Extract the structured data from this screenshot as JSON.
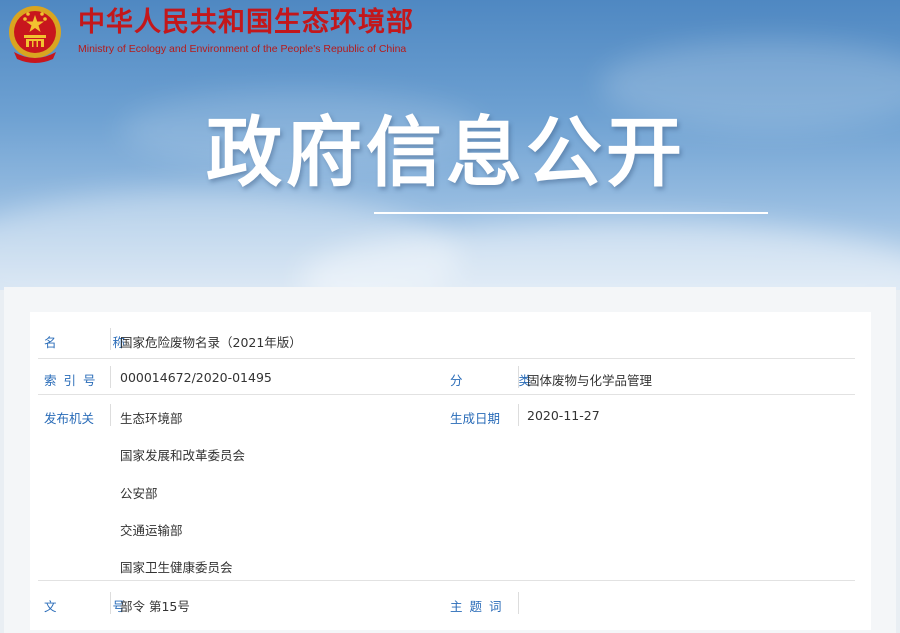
{
  "header": {
    "ministry_cn": "中华人民共和国生态环境部",
    "ministry_en": "Ministry of Ecology and Environment of the People's Republic of China",
    "headline": "政府信息公开"
  },
  "info": {
    "name": {
      "label": "名 称",
      "value": "国家危险废物名录（2021年版）"
    },
    "index": {
      "label": "索引号",
      "value": "000014672/2020-01495"
    },
    "category": {
      "label": "分 类",
      "value": "固体废物与化学品管理"
    },
    "issuer": {
      "label": "发布机关",
      "values": [
        "生态环境部",
        "国家发展和改革委员会",
        "公安部",
        "交通运输部",
        "国家卫生健康委员会"
      ]
    },
    "date": {
      "label": "生成日期",
      "value": "2020-11-27"
    },
    "doc_no": {
      "label": "文 号",
      "value": "部令 第15号"
    },
    "keywords": {
      "label": "主题词",
      "value": ""
    }
  },
  "colors": {
    "accent_red": "#c3171b",
    "label_blue": "#2a6cb8"
  }
}
